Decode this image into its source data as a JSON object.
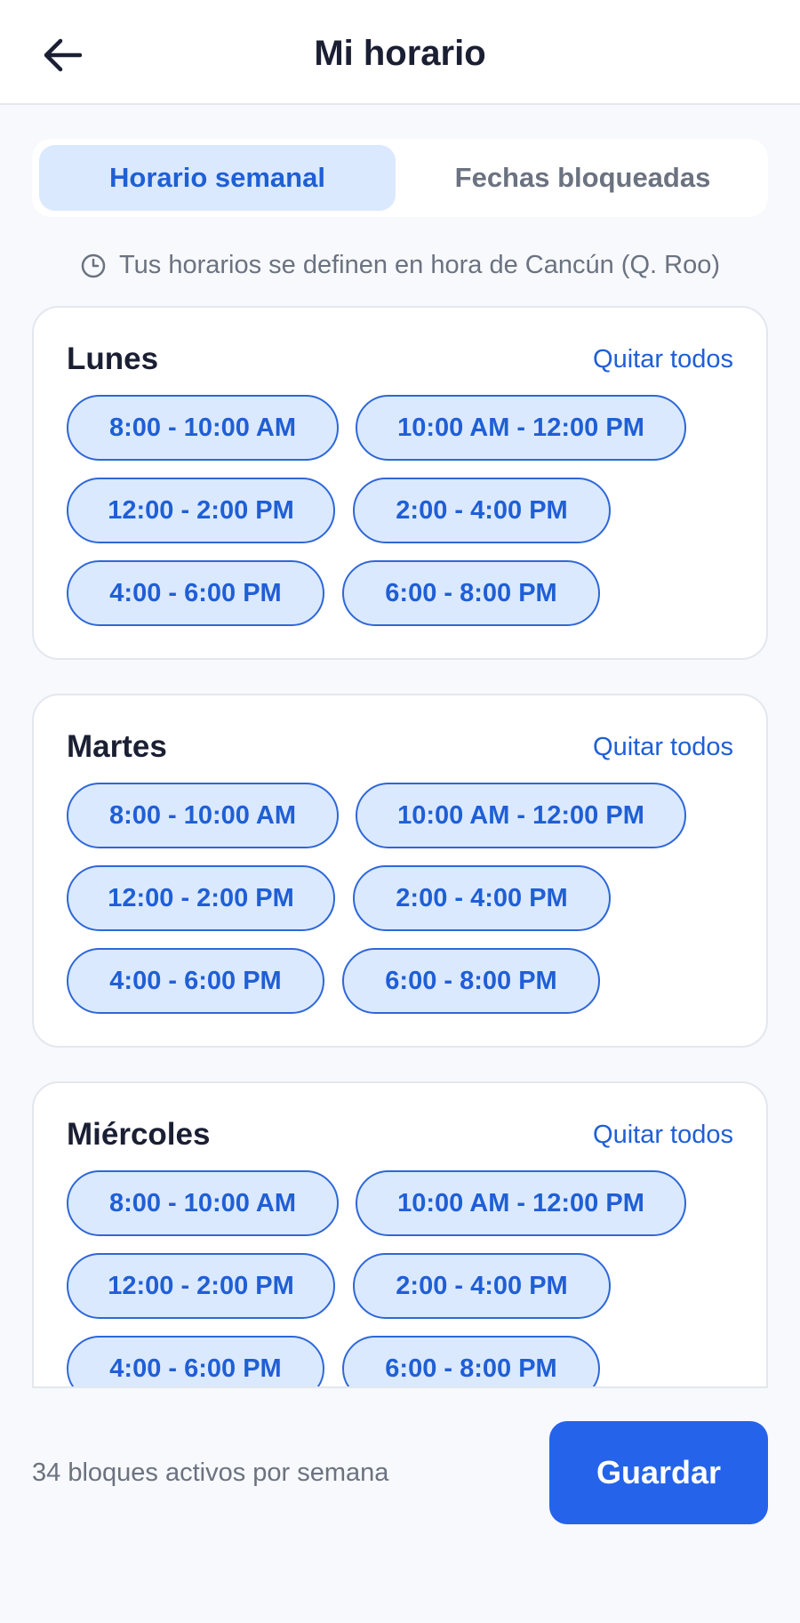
{
  "header": {
    "title": "Mi horario",
    "back_icon": "arrow-left-icon"
  },
  "tabs": [
    {
      "label": "Horario semanal",
      "active": true
    },
    {
      "label": "Fechas bloqueadas",
      "active": false
    }
  ],
  "timezone_note": {
    "icon": "clock-icon",
    "text": "Tus horarios se definen en hora de Cancún (Q. Roo)"
  },
  "days": [
    {
      "name": "Lunes",
      "remove_all_label": "Quitar todos",
      "slots": [
        "8:00 - 10:00 AM",
        "10:00 AM - 12:00 PM",
        "12:00 - 2:00 PM",
        "2:00 - 4:00 PM",
        "4:00 - 6:00 PM",
        "6:00 - 8:00 PM"
      ]
    },
    {
      "name": "Martes",
      "remove_all_label": "Quitar todos",
      "slots": [
        "8:00 - 10:00 AM",
        "10:00 AM - 12:00 PM",
        "12:00 - 2:00 PM",
        "2:00 - 4:00 PM",
        "4:00 - 6:00 PM",
        "6:00 - 8:00 PM"
      ]
    },
    {
      "name": "Miércoles",
      "remove_all_label": "Quitar todos",
      "slots": [
        "8:00 - 10:00 AM",
        "10:00 AM - 12:00 PM",
        "12:00 - 2:00 PM",
        "2:00 - 4:00 PM",
        "4:00 - 6:00 PM",
        "6:00 - 8:00 PM"
      ]
    }
  ],
  "footer": {
    "active_blocks_text": "34 bloques activos por semana",
    "save_label": "Guardar"
  },
  "colors": {
    "accent": "#2563eb",
    "chip_background": "#dbe9fe",
    "chip_text": "#1f5fd6"
  }
}
